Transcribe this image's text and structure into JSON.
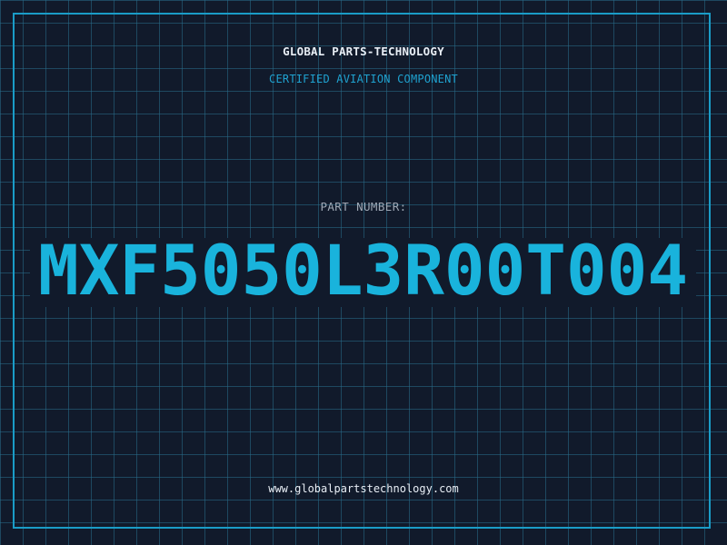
{
  "company_name": "GLOBAL PARTS-TECHNOLOGY",
  "subtitle": "CERTIFIED AVIATION COMPONENT",
  "part_number_label": "PART NUMBER:",
  "part_number": "MXF5050L3R00T004",
  "website": "www.globalpartstechnology.com",
  "colors": {
    "background": "#111a2b",
    "grid": "#286e8c",
    "frame": "#1a9cc7",
    "accent": "#1fa2d0",
    "part_number": "#19b3dc",
    "text_light": "#e8eef5",
    "text_muted": "#9fa9b6"
  }
}
